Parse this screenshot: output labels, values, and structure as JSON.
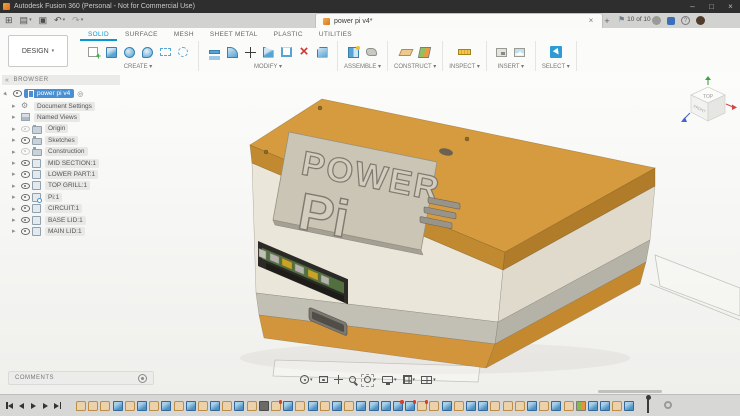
{
  "window": {
    "title": "Autodesk Fusion 360 (Personal - Not for Commercial Use)",
    "controls": [
      "minimize",
      "maximize",
      "close"
    ]
  },
  "tab_bar": {
    "quick_icons": [
      "application-menu",
      "file",
      "save",
      "undo",
      "redo"
    ],
    "document_tab": {
      "label": "power pi v4*"
    },
    "job_status": {
      "count_label": "10 of 10"
    },
    "help_label": "?"
  },
  "ribbon": {
    "workspace": "DESIGN",
    "tabs": [
      {
        "label": "SOLID",
        "active": true
      },
      {
        "label": "SURFACE",
        "active": false
      },
      {
        "label": "MESH",
        "active": false
      },
      {
        "label": "SHEET METAL",
        "active": false
      },
      {
        "label": "PLASTIC",
        "active": false
      },
      {
        "label": "UTILITIES",
        "active": false
      }
    ],
    "groups": [
      {
        "label": "CREATE",
        "icons": [
          "sketch-new",
          "solid-box",
          "revolve",
          "form-sphere",
          "dots-rect",
          "dots-circle"
        ]
      },
      {
        "label": "MODIFY",
        "icons": [
          "press-pull",
          "fillet",
          "move-cross",
          "offset-wedge",
          "shell",
          "delete-x",
          "chamfer"
        ]
      },
      {
        "label": "ASSEMBLE",
        "icons": [
          "new-component",
          "joint"
        ]
      },
      {
        "label": "CONSTRUCT",
        "icons": [
          "plane",
          "axis"
        ]
      },
      {
        "label": "INSPECT",
        "icons": [
          "measure"
        ]
      },
      {
        "label": "INSERT",
        "icons": [
          "decal",
          "canvas"
        ]
      },
      {
        "label": "SELECT",
        "icons": [
          "select"
        ]
      }
    ]
  },
  "browser": {
    "header": "BROWSER",
    "root": {
      "label": "power pi v4"
    },
    "items": [
      {
        "label": "Document Settings",
        "icon": "gear",
        "eye": null
      },
      {
        "label": "Named Views",
        "icon": "views",
        "eye": null
      },
      {
        "label": "Origin",
        "icon": "folder",
        "eye": "off"
      },
      {
        "label": "Sketches",
        "icon": "folder",
        "eye": "on"
      },
      {
        "label": "Construction",
        "icon": "folder",
        "eye": "off"
      },
      {
        "label": "MID SECTION:1",
        "icon": "component",
        "eye": "on"
      },
      {
        "label": "LOWER PART:1",
        "icon": "component",
        "eye": "on"
      },
      {
        "label": "TOP GRILL:1",
        "icon": "component",
        "eye": "on"
      },
      {
        "label": "Pi:1",
        "icon": "component-linked",
        "eye": "on"
      },
      {
        "label": "CIRCUIT:1",
        "icon": "component",
        "eye": "on"
      },
      {
        "label": "BASE LID:1",
        "icon": "component",
        "eye": "on"
      },
      {
        "label": "MAIN LID:1",
        "icon": "component",
        "eye": "on"
      }
    ]
  },
  "viewcube": {
    "top": "TOP",
    "front": "FRONT"
  },
  "model": {
    "badge_line1": "POWER",
    "badge_line2": "Pi",
    "colors": {
      "lid": "#D69B3F",
      "lid_side": "#C28A30",
      "lid_side_right": "#B17C2A",
      "body": "#EAE6DA",
      "body_right": "#DFDACC",
      "band_gray": "#C2BFB5",
      "band_gray_right": "#B5B2A7",
      "base_orange": "#D2953C",
      "base_orange_right": "#C4892F",
      "plate": "#CBC5B6"
    }
  },
  "comments": {
    "label": "COMMENTS"
  },
  "nav_toolbar": {
    "buttons": [
      {
        "name": "orbit",
        "caret": true
      },
      {
        "name": "look-at",
        "caret": false
      },
      {
        "name": "pan",
        "caret": false
      },
      {
        "name": "zoom",
        "caret": false
      },
      {
        "name": "fit",
        "caret": true
      },
      {
        "name": "display-settings",
        "caret": true
      },
      {
        "name": "grid-display",
        "caret": true
      },
      {
        "name": "viewports",
        "caret": true
      }
    ]
  },
  "timeline": {
    "playback": [
      "go-to-start",
      "step-back",
      "play",
      "step-forward",
      "go-to-end"
    ],
    "features": [
      "sketch",
      "sketch",
      "sketch",
      "feature",
      "sketch",
      "feature",
      "sketch",
      "feature",
      "sketch",
      "feature",
      "sketch",
      "feature",
      "sketch",
      "feature",
      "sketch",
      "move",
      "sketch-red",
      "feature",
      "sketch",
      "feature",
      "sketch",
      "feature",
      "sketch",
      "feature",
      "feature",
      "feature",
      "feature-red",
      "feature-red",
      "sketch-red",
      "sketch",
      "feature",
      "sketch",
      "feature",
      "feature",
      "sketch",
      "sketch",
      "sketch",
      "feature",
      "sketch",
      "feature",
      "sketch",
      "appearance",
      "feature",
      "feature",
      "sketch",
      "feature"
    ]
  }
}
